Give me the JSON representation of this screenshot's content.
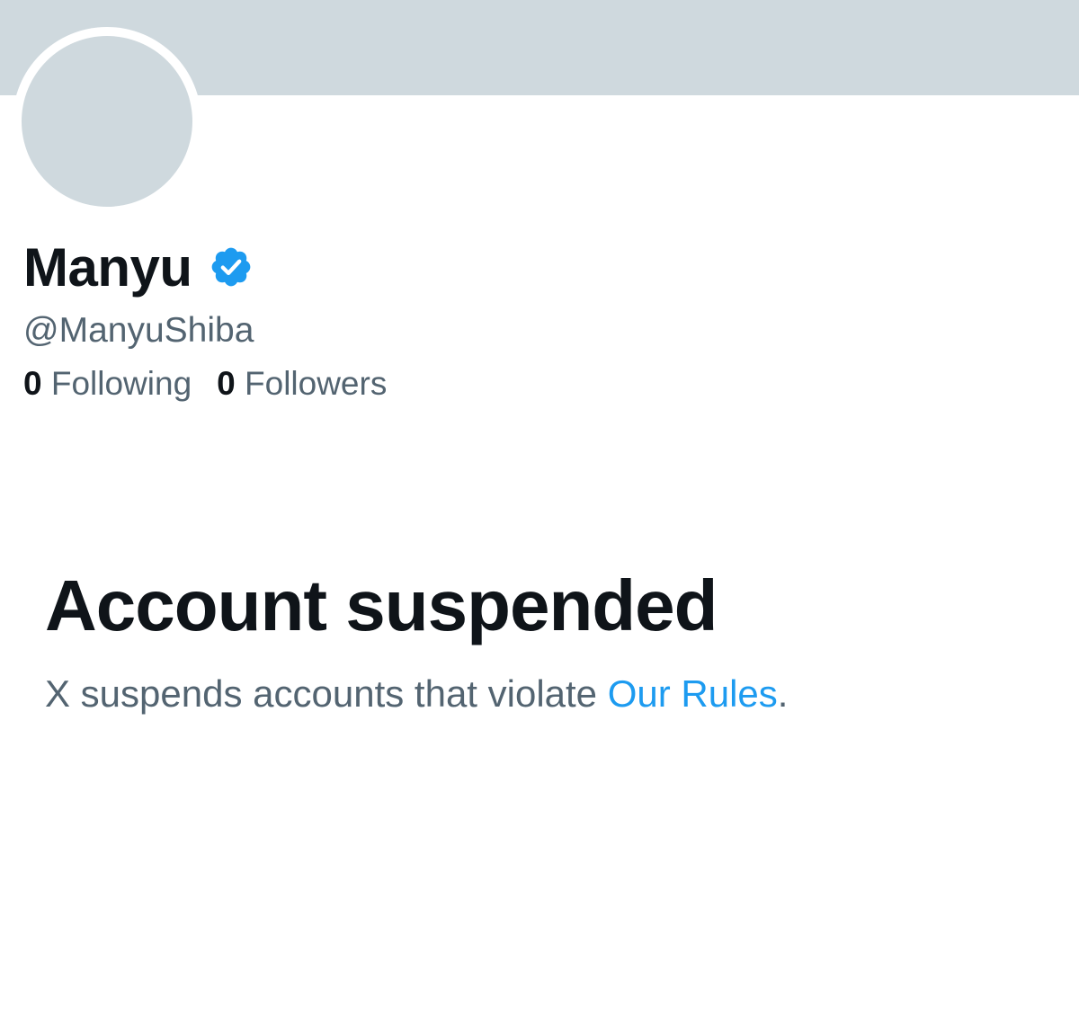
{
  "profile": {
    "display_name": "Manyu",
    "handle": "@ManyuShiba",
    "verified_badge_icon": "verified-check-icon",
    "stats": {
      "following_count": "0",
      "following_label": "Following",
      "followers_count": "0",
      "followers_label": "Followers"
    }
  },
  "suspension": {
    "title": "Account suspended",
    "message": "X suspends accounts that violate ",
    "link_text": "Our Rules",
    "trailing": "."
  },
  "colors": {
    "banner": "#cfd9de",
    "avatar": "#cfd9de",
    "verified_blue": "#1d9bf0",
    "text_primary": "#0f1419",
    "text_secondary": "#536471",
    "link": "#1d9bf0"
  }
}
